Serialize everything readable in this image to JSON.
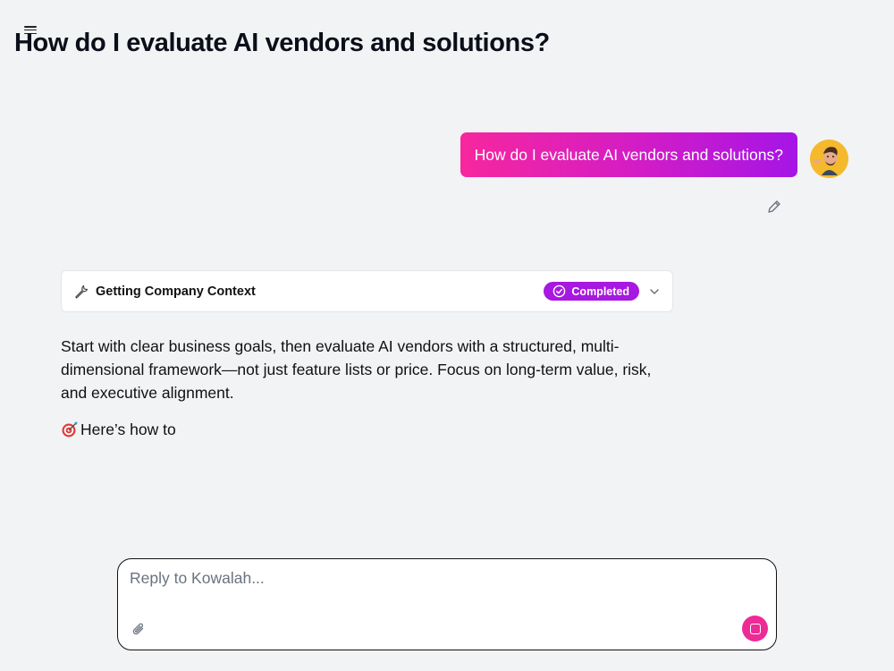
{
  "header": {
    "title": "How do I evaluate AI vendors and solutions?",
    "menu_icon": "hamburger-icon"
  },
  "conversation": {
    "user_message": "How do I evaluate AI vendors and solutions?",
    "user_avatar": "user-avatar",
    "edit_icon": "pencil-icon",
    "tool_call": {
      "icon": "wrench-icon",
      "label": "Getting Company Context",
      "status": "Completed",
      "status_icon": "check-circle-icon",
      "expand_icon": "chevron-down-icon"
    },
    "assistant_paragraph": "Start with clear business goals, then evaluate AI vendors with a structured, multi-dimensional framework—not just feature lists or price. Focus on long-term value, risk, and executive alignment.",
    "assistant_emoji": "🎯",
    "assistant_partial": "Here’s how to"
  },
  "composer": {
    "placeholder": "Reply to Kowalah...",
    "value": "",
    "attach_icon": "paperclip-icon",
    "stop_icon": "stop-icon"
  },
  "colors": {
    "background": "#f2f3f5",
    "accent_pink": "#f7279e",
    "accent_purple": "#a515e6",
    "badge": "#a718e0",
    "stop_button": "#ee2a97"
  }
}
